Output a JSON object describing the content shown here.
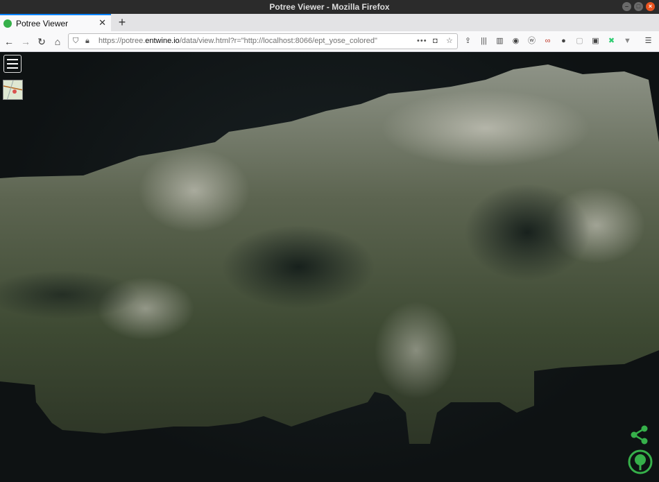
{
  "window": {
    "title": "Potree Viewer - Mozilla Firefox"
  },
  "tab": {
    "label": "Potree Viewer"
  },
  "url": {
    "scheme": "https://potree.",
    "host": "entwine.io",
    "path": "/data/view.html?r=\"http://localhost:8066/ept_yose_colored\""
  },
  "icons": {
    "back": "back-arrow-icon",
    "forward": "forward-arrow-icon",
    "reload": "reload-icon",
    "home": "home-icon",
    "menu": "hamburger-menu-icon",
    "share": "share-icon",
    "potree_logo": "potree-logo-icon"
  },
  "colors": {
    "accent": "#0a84ff",
    "potree_green": "#36b04a",
    "close_button": "#e95420"
  }
}
